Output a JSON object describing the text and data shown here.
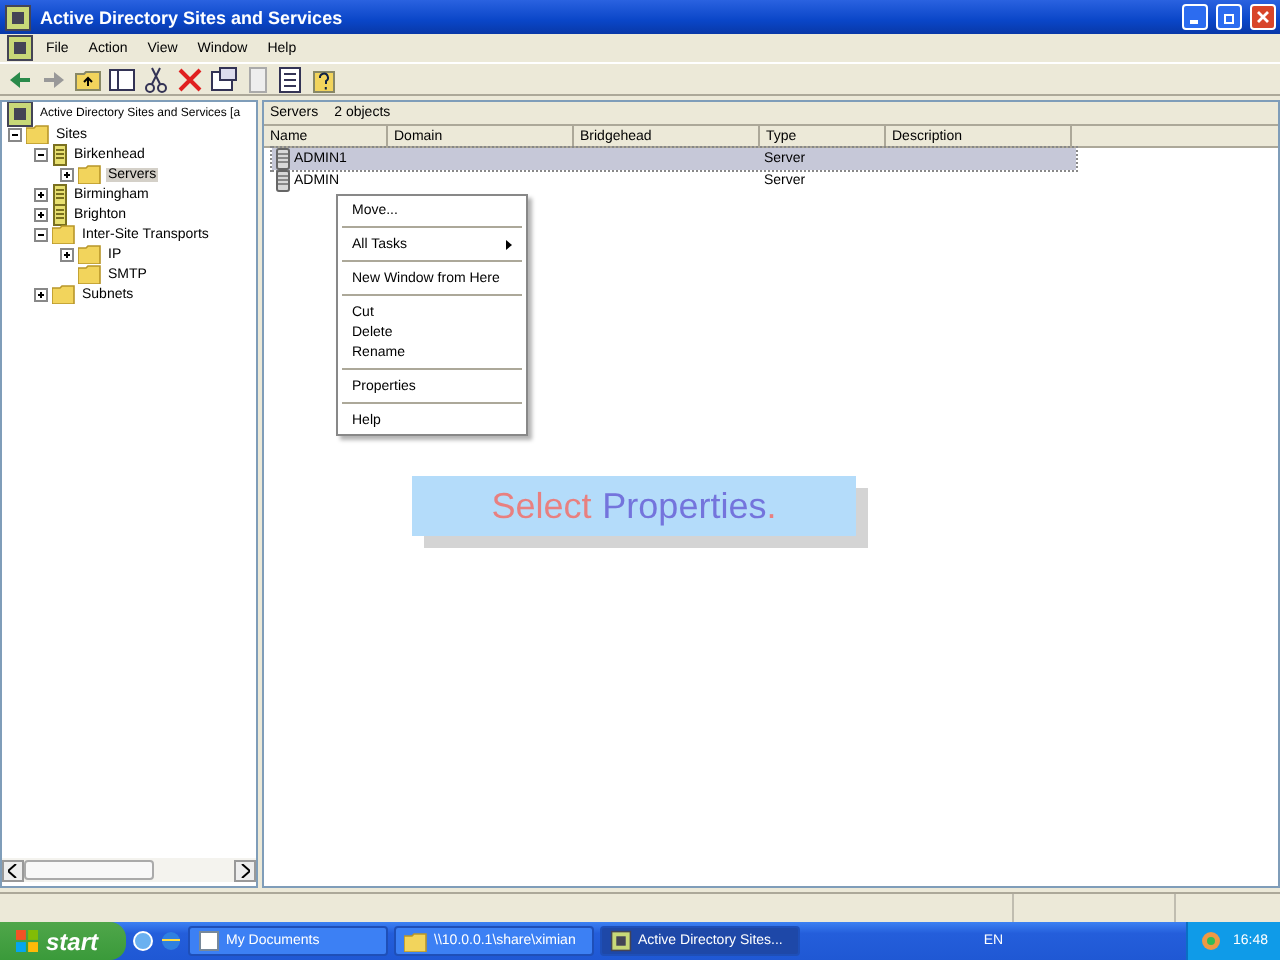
{
  "window": {
    "title": "Active Directory Sites and Services"
  },
  "menu_bar": [
    "File",
    "Action",
    "View",
    "Window",
    "Help"
  ],
  "tree": {
    "root": "Active Directory Sites and Services [a",
    "items": [
      {
        "label": "Sites",
        "kind": "folder",
        "expanded": true,
        "selected": false,
        "children": [
          {
            "label": "Birkenhead",
            "kind": "site",
            "expanded": true,
            "selected": false,
            "children": [
              {
                "label": "Servers",
                "kind": "folder",
                "expanded": false,
                "selected": true
              }
            ]
          },
          {
            "label": "Birmingham",
            "kind": "site",
            "expanded": false,
            "selected": false
          },
          {
            "label": "Brighton",
            "kind": "site",
            "expanded": false,
            "selected": false
          },
          {
            "label": "Inter-Site Transports",
            "kind": "folder",
            "expanded": true,
            "selected": false,
            "children": [
              {
                "label": "IP",
                "kind": "folder",
                "expanded": false,
                "selected": false
              },
              {
                "label": "SMTP",
                "kind": "folder",
                "selected": false
              }
            ]
          },
          {
            "label": "Subnets",
            "kind": "folder",
            "expanded": false,
            "selected": false
          }
        ]
      }
    ]
  },
  "list": {
    "header": "Servers",
    "count": "2 objects",
    "columns": [
      "Name",
      "Domain",
      "Bridgehead",
      "Type",
      "Description"
    ],
    "rows": [
      {
        "name": "ADMIN1",
        "type": "Server",
        "selected": true
      },
      {
        "name": "ADMIN",
        "type": "Server",
        "selected": false
      }
    ]
  },
  "context_menu": {
    "items": [
      {
        "kind": "item",
        "label": "Move..."
      },
      {
        "kind": "separator"
      },
      {
        "kind": "submenu",
        "label": "All Tasks"
      },
      {
        "kind": "separator"
      },
      {
        "kind": "item",
        "label": "New Window from Here"
      },
      {
        "kind": "separator"
      },
      {
        "kind": "item",
        "label": "Cut"
      },
      {
        "kind": "item",
        "label": "Delete"
      },
      {
        "kind": "item",
        "label": "Rename"
      },
      {
        "kind": "separator"
      },
      {
        "kind": "item",
        "label": "Properties"
      },
      {
        "kind": "separator"
      },
      {
        "kind": "item",
        "label": "Help"
      }
    ]
  },
  "callout": {
    "parts": [
      {
        "text": "Select",
        "color": "#e88080"
      },
      {
        "text": "Properties",
        "color": "#7474dc"
      },
      {
        "text": ".",
        "color": "#e88080"
      }
    ]
  },
  "taskbar": {
    "start": "start",
    "buttons": [
      {
        "label": "My Documents",
        "kind": "docs",
        "selected": false
      },
      {
        "label": "\\\\10.0.0.1\\share\\ximian",
        "kind": "folder",
        "selected": false
      },
      {
        "label": "Active Directory Sites...",
        "kind": "app",
        "selected": true
      }
    ],
    "language": "EN",
    "clock": "16:48"
  }
}
